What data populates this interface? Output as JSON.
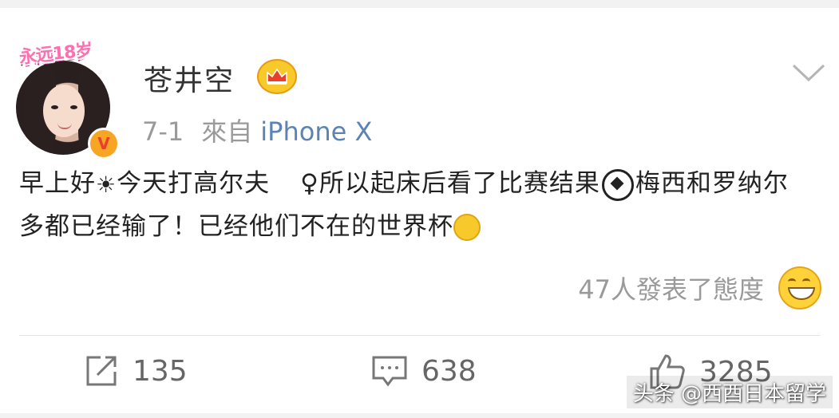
{
  "user": {
    "name": "苍井空",
    "frame_text": "永远18岁",
    "verified_mark": "V"
  },
  "meta": {
    "date": "7-1",
    "from": "來自",
    "source": "iPhone X"
  },
  "post": {
    "part1": "早上好",
    "part2": "今天打高尔夫",
    "part3": "♀所以起床后看了比赛结果",
    "part4": "梅西和罗纳尔多都已经输了！已经他们不在的世界杯",
    "sun_icon": "☀",
    "icons": [
      "sun-icon",
      "soccer-ball-icon",
      "laughing-tears-icon"
    ]
  },
  "reactions": {
    "text": "47人發表了態度",
    "icon": "grin-emoji-icon"
  },
  "actions": {
    "repost_count": "135",
    "comment_count": "638",
    "like_count": "3285"
  },
  "watermark": {
    "text": "头条 @西酉日本留学"
  },
  "colors": {
    "link": "#5b83b4",
    "muted": "#9a9a9a",
    "verified": "#f7a623"
  }
}
